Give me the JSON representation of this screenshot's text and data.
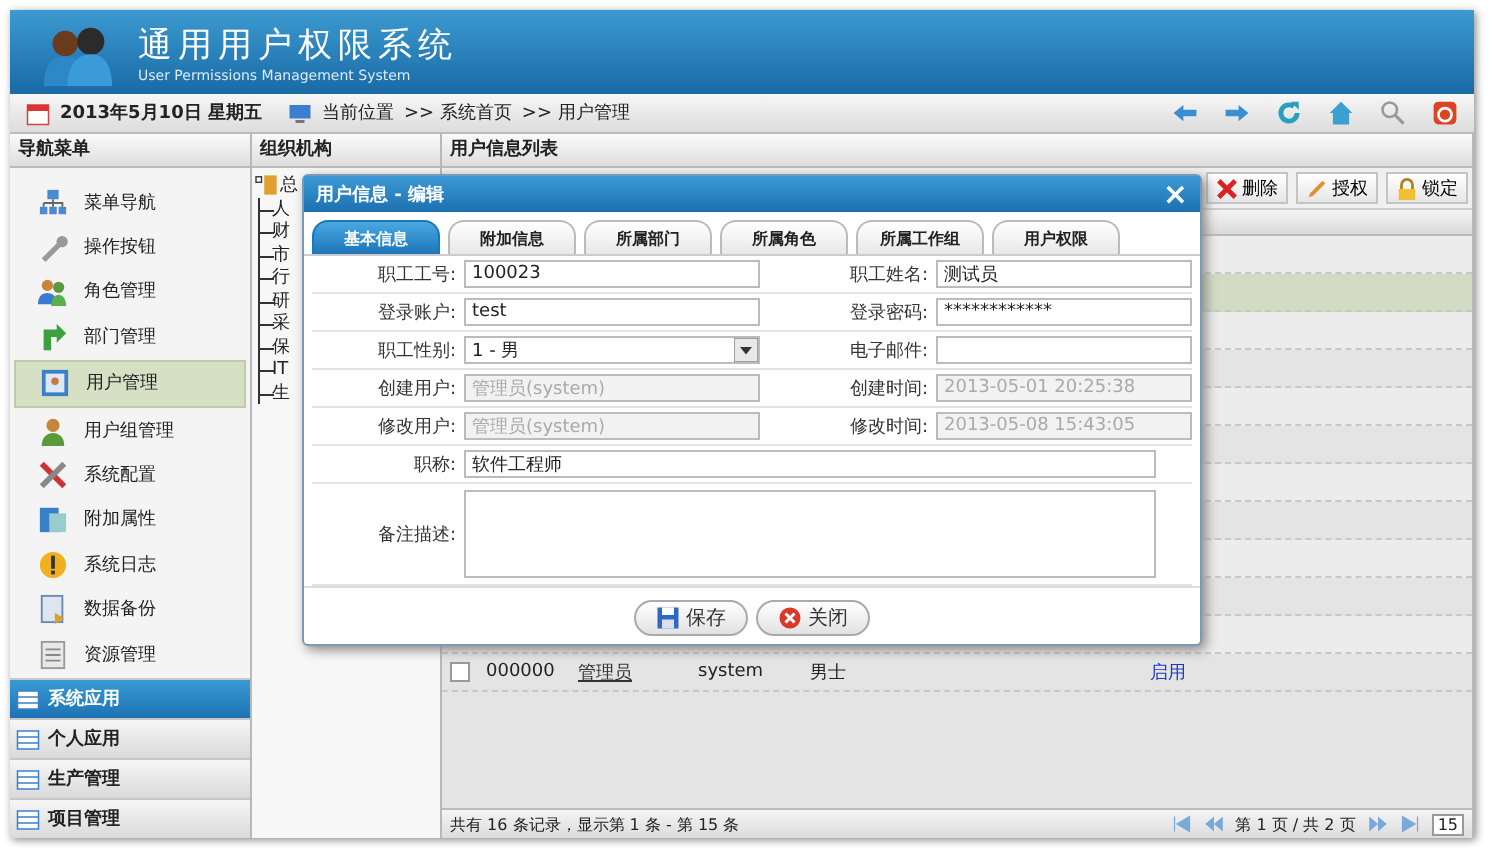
{
  "header": {
    "title": "通用用户权限系统",
    "subtitle": "User Permissions Management System"
  },
  "info_bar": {
    "date": "2013年5月10日 星期五",
    "location_label": "当前位置",
    "breadcrumb": [
      ">> 系统首页",
      ">> 用户管理"
    ]
  },
  "nav": {
    "title": "导航菜单",
    "items": [
      {
        "label": "菜单导航",
        "selected": false
      },
      {
        "label": "操作按钮",
        "selected": false
      },
      {
        "label": "角色管理",
        "selected": false
      },
      {
        "label": "部门管理",
        "selected": false
      },
      {
        "label": "用户管理",
        "selected": true
      },
      {
        "label": "用户组管理",
        "selected": false
      },
      {
        "label": "系统配置",
        "selected": false
      },
      {
        "label": "附加属性",
        "selected": false
      },
      {
        "label": "系统日志",
        "selected": false
      },
      {
        "label": "数据备份",
        "selected": false
      },
      {
        "label": "资源管理",
        "selected": false
      }
    ],
    "sections": [
      {
        "label": "系统应用",
        "selected": true
      },
      {
        "label": "个人应用",
        "selected": false
      },
      {
        "label": "生产管理",
        "selected": false
      },
      {
        "label": "项目管理",
        "selected": false
      }
    ]
  },
  "org": {
    "title": "组织机构",
    "root": "总",
    "children": [
      "人",
      "财",
      "市",
      "行",
      "研",
      "采",
      "保",
      "IT",
      "生"
    ]
  },
  "list": {
    "title": "用户信息列表",
    "toolbar": [
      "删除",
      "授权",
      "锁定"
    ],
    "rows": [
      {
        "selected": false
      },
      {
        "selected": true
      },
      {
        "selected": false
      },
      {
        "selected": false
      },
      {
        "selected": false
      },
      {
        "selected": false
      },
      {
        "selected": false
      },
      {
        "selected": false
      },
      {
        "selected": false
      },
      {
        "selected": false
      },
      {
        "selected": false
      },
      {
        "selected": false,
        "cells": [
          "000000",
          "管理员",
          "system",
          "男士",
          "启用"
        ]
      }
    ],
    "status": "共有 16 条记录，显示第 1 条 - 第 15 条",
    "pager": "第 1 页 / 共 2 页",
    "page_size": "15"
  },
  "dialog": {
    "title": "用户信息 - 编辑",
    "close": "×",
    "tabs": [
      {
        "label": "基本信息",
        "selected": true
      },
      {
        "label": "附加信息",
        "selected": false
      },
      {
        "label": "所属部门",
        "selected": false
      },
      {
        "label": "所属角色",
        "selected": false
      },
      {
        "label": "所属工作组",
        "selected": false
      },
      {
        "label": "用户权限",
        "selected": false
      }
    ],
    "rows": [
      [
        {
          "label": "职工工号:",
          "kind": "text",
          "value": "100023",
          "disabled": false
        },
        {
          "label": "职工姓名:",
          "kind": "text",
          "value": "测试员",
          "disabled": false
        }
      ],
      [
        {
          "label": "登录账户:",
          "kind": "text",
          "value": "test",
          "disabled": false
        },
        {
          "label": "登录密码:",
          "kind": "text",
          "value": "************",
          "disabled": false
        }
      ],
      [
        {
          "label": "职工性别:",
          "kind": "select",
          "value": "1 - 男",
          "disabled": false
        },
        {
          "label": "电子邮件:",
          "kind": "text",
          "disabled": false
        }
      ],
      [
        {
          "label": "创建用户:",
          "kind": "text",
          "value": "管理员(system)",
          "disabled": true
        },
        {
          "label": "创建时间:",
          "kind": "text",
          "value": "2013-05-01 20:25:38",
          "disabled": true
        }
      ],
      [
        {
          "label": "修改用户:",
          "kind": "text",
          "value": "管理员(system)",
          "disabled": true
        },
        {
          "label": "修改时间:",
          "kind": "text",
          "value": "2013-05-08 15:43:05",
          "disabled": true
        }
      ],
      [
        {
          "label": "职称:",
          "kind": "text",
          "value": "软件工程师",
          "disabled": false
        }
      ],
      [
        {
          "label": "备注描述:",
          "kind": "textarea",
          "disabled": false
        }
      ]
    ],
    "buttons": [
      "保存",
      "关闭"
    ]
  }
}
